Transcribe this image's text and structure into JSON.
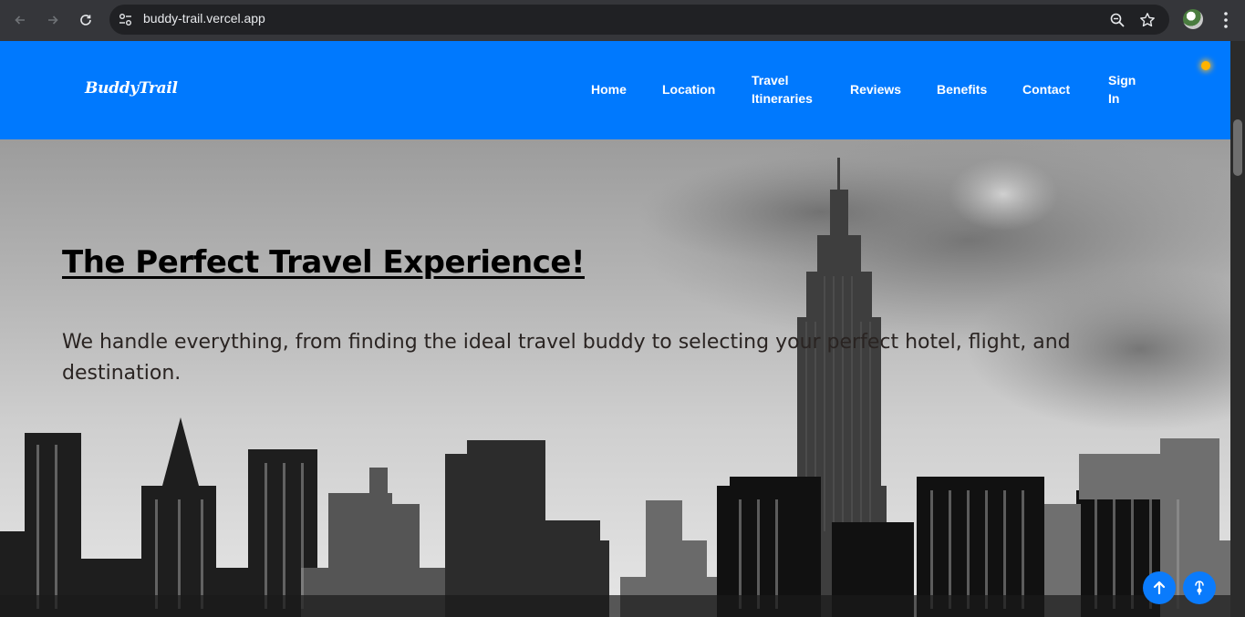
{
  "browser": {
    "url": "buddy-trail.vercel.app",
    "icons": [
      "back-arrow-icon",
      "forward-arrow-icon",
      "reload-icon",
      "site-settings-icon",
      "zoom-icon",
      "bookmark-star-icon",
      "profile-avatar",
      "menu-kebab-icon"
    ]
  },
  "nav": {
    "logo": "BuddyTrail",
    "links": [
      {
        "label": "Home"
      },
      {
        "label": "Location"
      },
      {
        "label_line1": "Travel",
        "label_line2": "Itineraries"
      },
      {
        "label": "Reviews"
      },
      {
        "label": "Benefits"
      },
      {
        "label": "Contact"
      },
      {
        "label_line1": "Sign",
        "label_line2": "In"
      }
    ]
  },
  "hero": {
    "title": "The Perfect Travel Experience!",
    "text": "We handle everything, from finding the ideal travel buddy to selecting your perfect hotel, flight, and destination."
  },
  "colors": {
    "nav_bg": "#0079fe",
    "fab_bg": "#0a7bfc",
    "status_dot": "#ffb300"
  },
  "fabs": {
    "scroll_top_icon": "arrow-up-icon",
    "cursor_icon": "cursor-pointer-icon"
  }
}
